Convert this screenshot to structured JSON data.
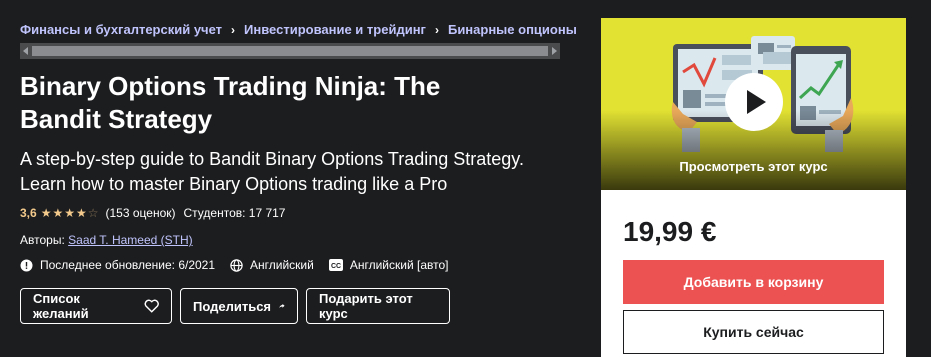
{
  "breadcrumb": [
    "Финансы и бухгалтерский учет",
    "Инвестирование и трейдинг",
    "Бинарные опционы"
  ],
  "title": "Binary Options Trading Ninja: The Bandit Strategy",
  "subtitle": "A step-by-step guide to Bandit Binary Options Trading Strategy. Learn how to master Binary Options trading like a Pro",
  "rating": {
    "value": "3,6",
    "stars": 3.5,
    "reviews": "(153 оценок)",
    "students": "Студентов: 17 717"
  },
  "authors": {
    "label": "Авторы:",
    "name": "Saad T. Hameed (STH)"
  },
  "meta": {
    "updated": "Последнее обновление: 6/2021",
    "language": "Английский",
    "captions": "Английский [авто]",
    "captions_icon_text": "CC"
  },
  "actions": {
    "wishlist": "Список желаний",
    "share": "Поделиться",
    "gift": "Подарить этот курс"
  },
  "sidebar": {
    "preview_label": "Просмотреть этот курс",
    "price": "19,99 €",
    "add_to_cart": "Добавить в корзину",
    "buy_now": "Купить сейчас"
  },
  "colors": {
    "accent_purple": "#c0c4fc",
    "star": "#f3ca8c",
    "cart_red": "#ec5252",
    "preview_yellow": "#e2e233"
  }
}
